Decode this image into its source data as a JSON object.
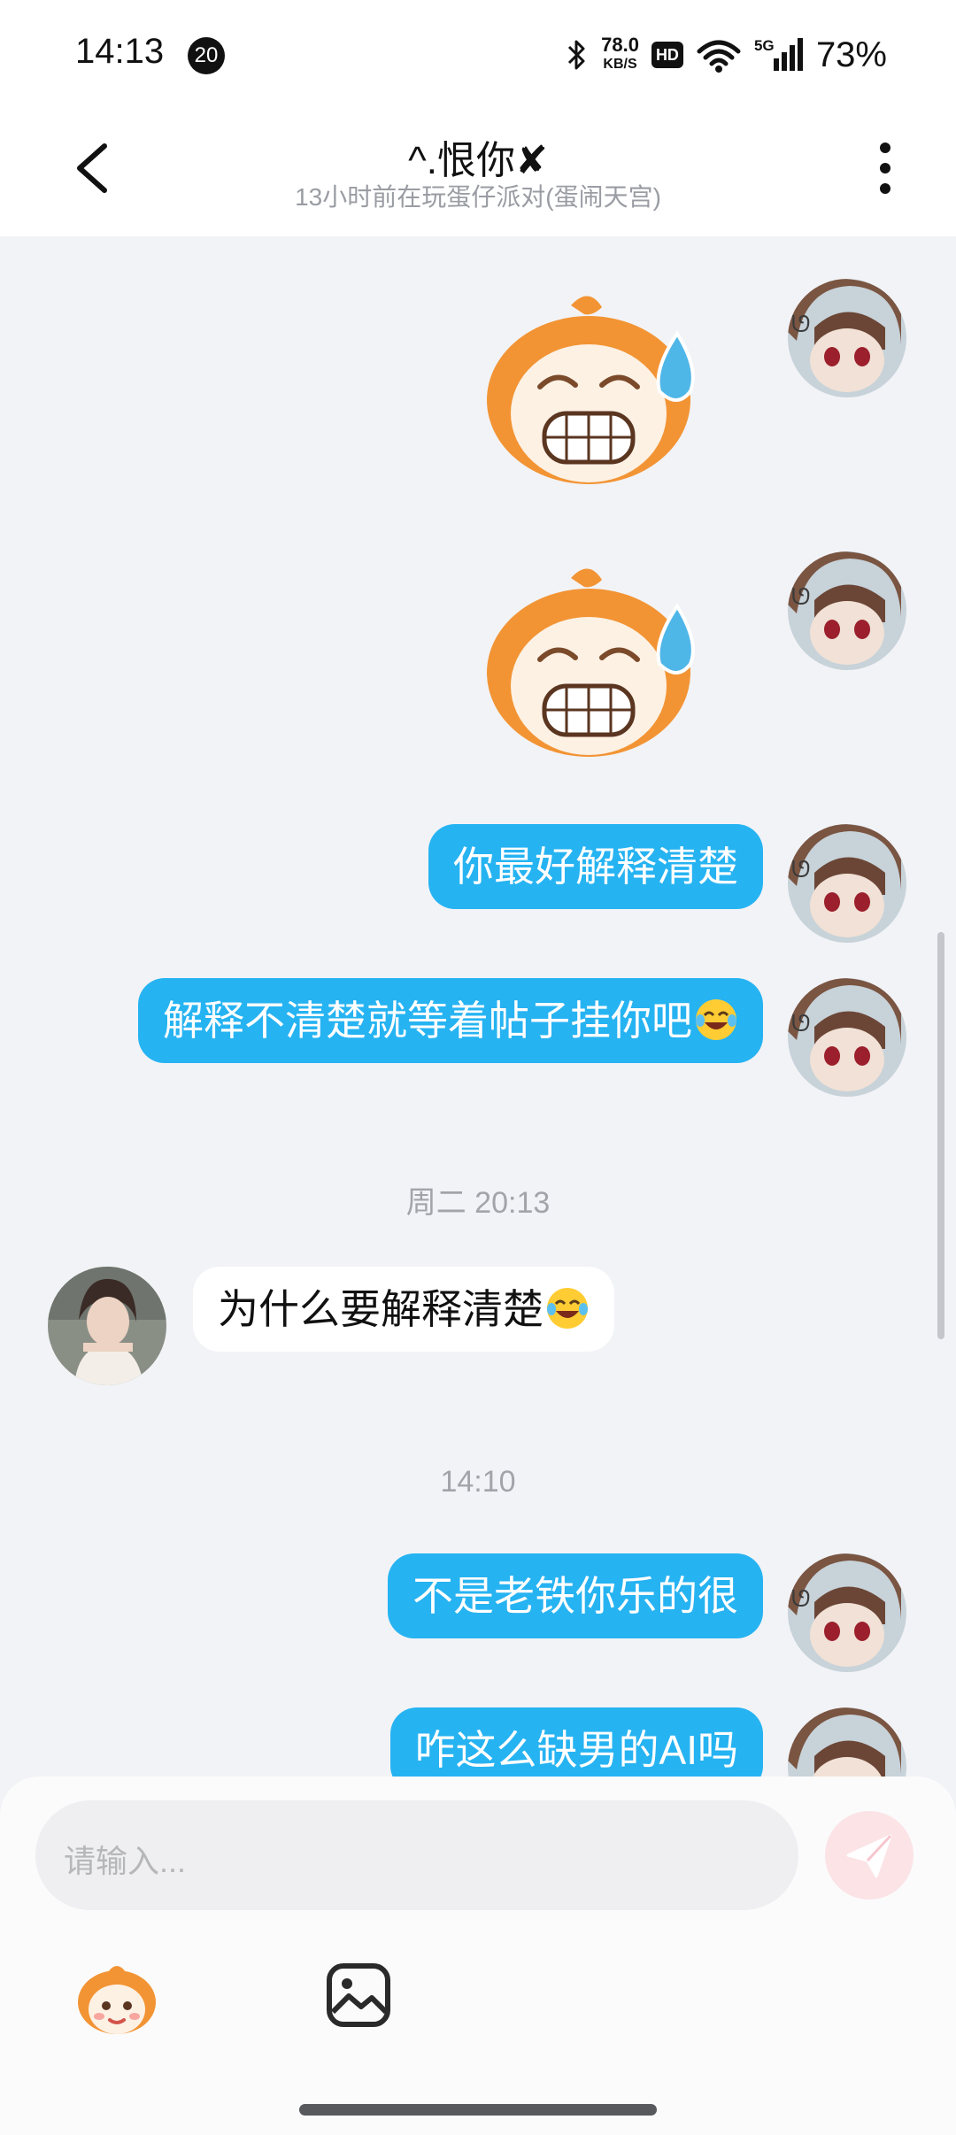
{
  "status_bar": {
    "time": "14:13",
    "notification_count": "20",
    "net_speed": "78.0",
    "net_speed_unit": "KB/S",
    "hd_label": "HD",
    "network_type": "5G",
    "battery": "73%"
  },
  "header": {
    "title": "^.恨你✘",
    "subtitle": "13小时前在玩蛋仔派对(蛋闹天宫)"
  },
  "messages": {
    "m1_sticker": "sweating-eggy-sticker",
    "m2_sticker": "sweating-eggy-sticker",
    "m3": "你最好解释清楚",
    "m4": "解释不清楚就等着帖子挂你吧",
    "ts1": "周二 20:13",
    "m5": "为什么要解释清楚",
    "ts2": "14:10",
    "m6": "不是老铁你乐的很",
    "m7": "咋这么缺男的AI吗"
  },
  "composer": {
    "placeholder": "请输入..."
  },
  "icons": {
    "back": "chevron-left-icon",
    "more": "more-vertical-icon",
    "send": "send-icon",
    "emoji": "laughing-tears-emoji",
    "sticker_tool": "eggy-sticker-icon",
    "image_tool": "image-icon"
  },
  "colors": {
    "my_bubble": "#26b3f2",
    "their_bubble": "#ffffff",
    "chat_background": "#f2f3f7",
    "send_button": "#fbe3e6"
  }
}
